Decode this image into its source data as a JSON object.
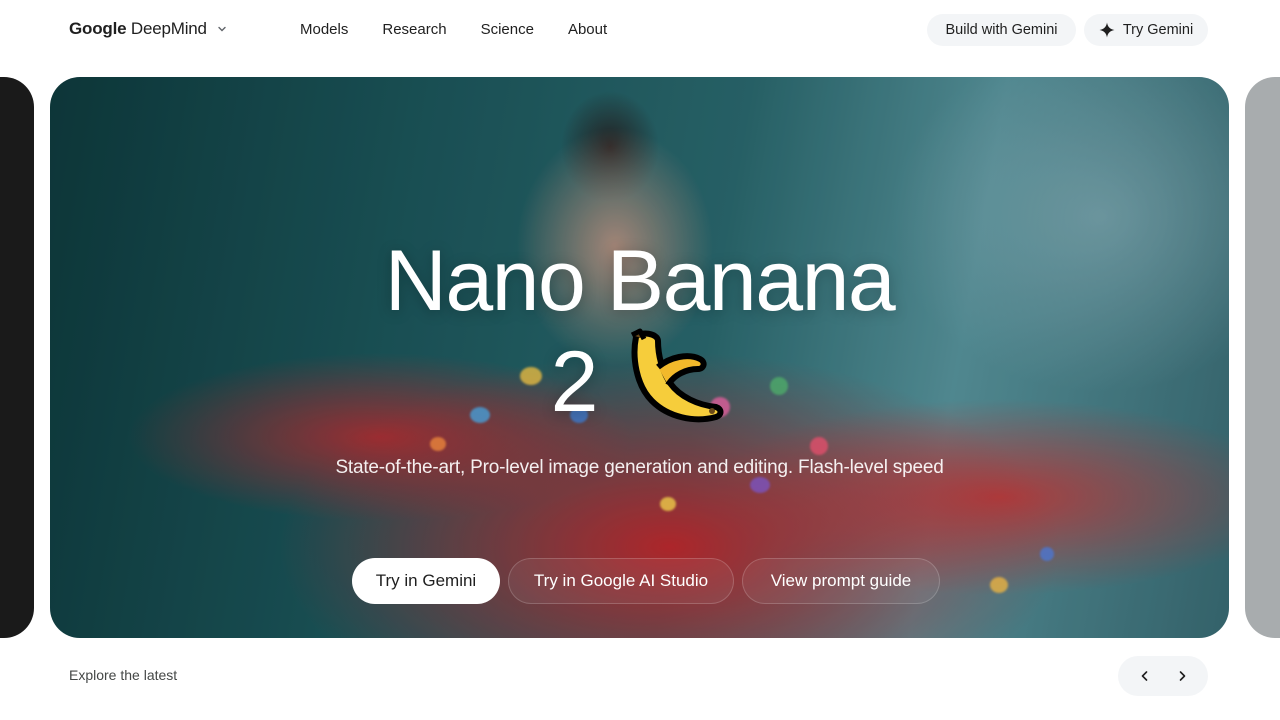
{
  "header": {
    "brand": {
      "name_part1": "Google",
      "name_part2": "DeepMind",
      "dropdown_icon": "chevron-down-icon"
    },
    "nav": [
      {
        "label": "Models"
      },
      {
        "label": "Research"
      },
      {
        "label": "Science"
      },
      {
        "label": "About"
      }
    ],
    "build_button": "Build with Gemini",
    "try_button": {
      "label": "Try Gemini",
      "icon": "sparkle-icon"
    }
  },
  "hero": {
    "title_line1": "Nano Banana",
    "title_line2": "2",
    "title_emoji": "banana-icon",
    "subtitle": "State-of-the-art, Pro-level image generation and editing. Flash-level speed",
    "buttons": [
      {
        "label": "Try in Gemini",
        "style": "primary"
      },
      {
        "label": "Try in Google AI Studio",
        "style": "ghost"
      },
      {
        "label": "View prompt guide",
        "style": "ghost"
      }
    ]
  },
  "footer": {
    "explore_label": "Explore the latest",
    "prev_icon": "chevron-left-icon",
    "next_icon": "chevron-right-icon"
  },
  "colors": {
    "accent_dark": "#1f1f1f",
    "pill_bg": "#f3f5f7",
    "hero_red": "#cd282d",
    "hero_teal": "#1d5a5f"
  }
}
